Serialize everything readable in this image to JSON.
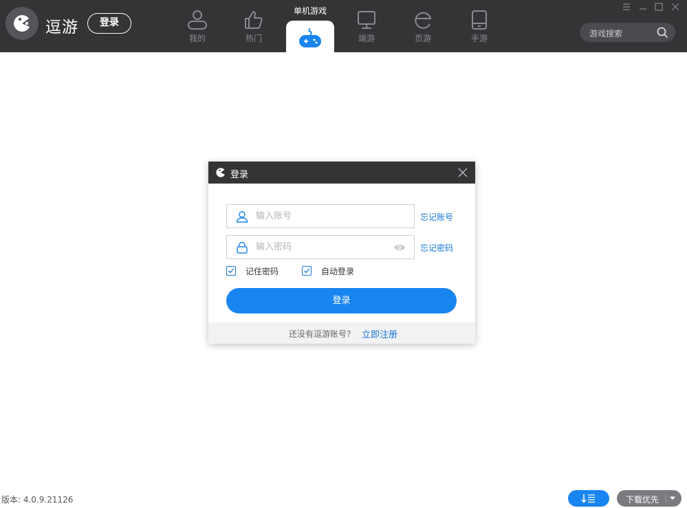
{
  "topbar": {
    "app_name": "逗游",
    "login_label": "登录",
    "nav": [
      {
        "label": "我的",
        "icon": "user-icon"
      },
      {
        "label": "热门",
        "icon": "thumbs-up-icon"
      },
      {
        "label": "单机游戏",
        "icon": "gamepad-icon",
        "active": true
      },
      {
        "label": "端游",
        "icon": "monitor-icon"
      },
      {
        "label": "页游",
        "icon": "browser-e-icon"
      },
      {
        "label": "手游",
        "icon": "phone-icon"
      }
    ],
    "search_placeholder": "游戏搜索"
  },
  "dialog": {
    "title": "登录",
    "account_placeholder": "输入账号",
    "password_placeholder": "输入密码",
    "forgot_account": "忘记账号",
    "forgot_password": "忘记密码",
    "remember_password": "记住密码",
    "auto_login": "自动登录",
    "remember_checked": true,
    "auto_login_checked": true,
    "submit_label": "登录",
    "no_account_text": "还没有逗游账号?",
    "register_link": "立即注册"
  },
  "footer": {
    "version": "版本: 4.0.9.21126",
    "download_priority": "下载优先"
  },
  "colors": {
    "topbar_bg": "#333436",
    "accent": "#1985f0",
    "link": "#1677d8"
  }
}
